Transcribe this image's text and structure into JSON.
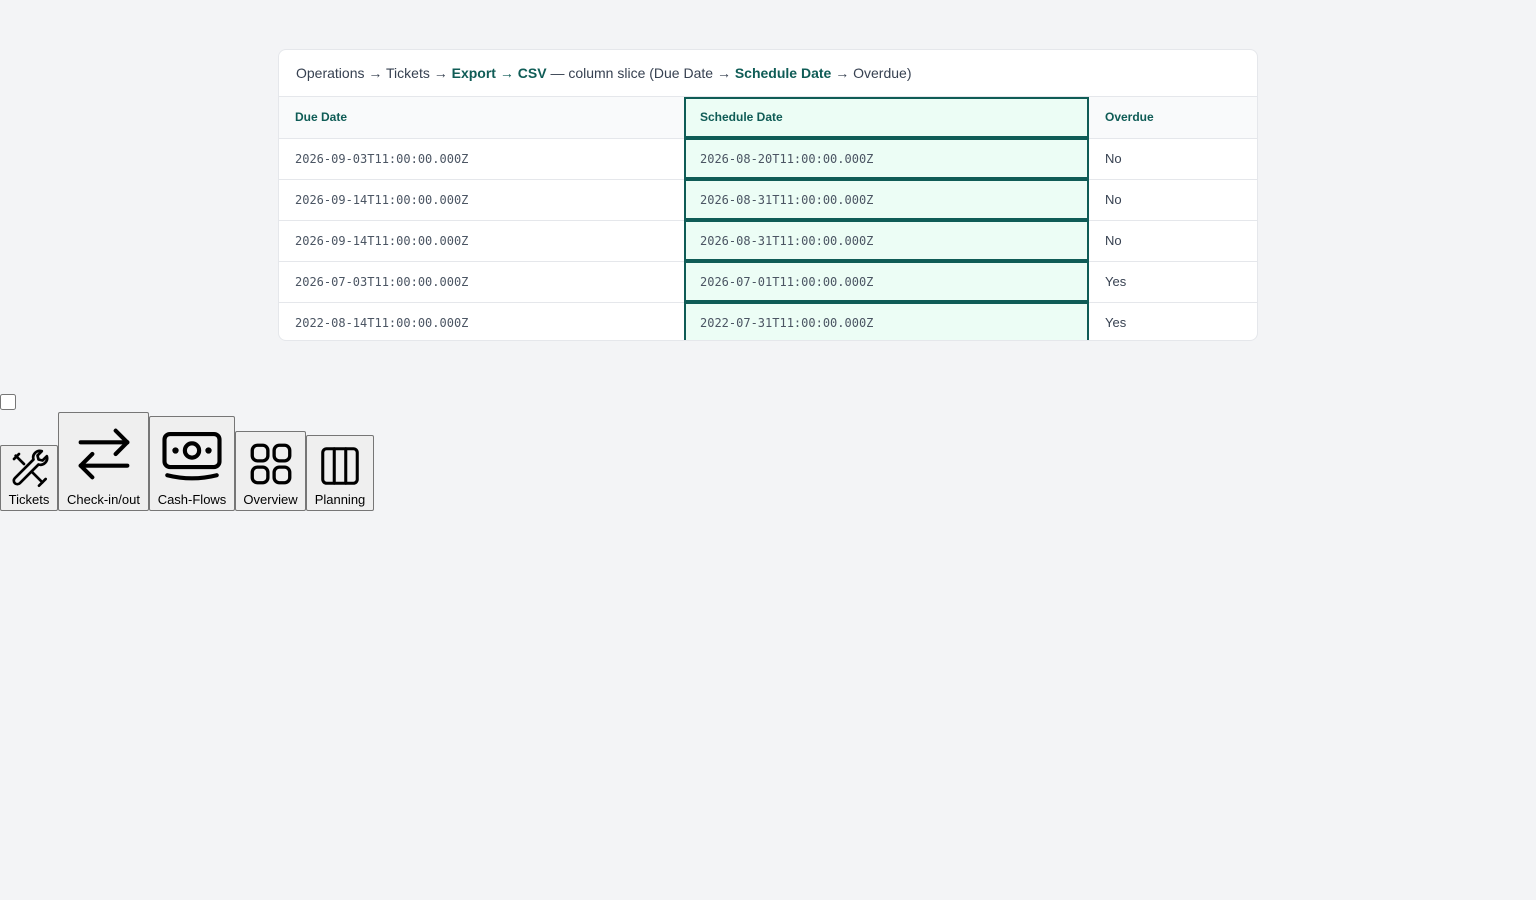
{
  "breadcrumb": {
    "seg1": "Operations",
    "seg2": "Tickets",
    "seg3": "Export",
    "seg4": "CSV",
    "desc_prefix": "— column slice (",
    "col_a": "Due Date",
    "col_b": "Schedule Date",
    "col_c": "Overdue",
    "desc_suffix": ")",
    "arrow": "→"
  },
  "table": {
    "headers": [
      "Due Date",
      "Schedule Date",
      "Overdue"
    ],
    "rows": [
      [
        "2026-09-03T11:00:00.000Z",
        "2026-08-20T11:00:00.000Z",
        "No"
      ],
      [
        "2026-09-14T11:00:00.000Z",
        "2026-08-31T11:00:00.000Z",
        "No"
      ],
      [
        "2026-09-14T11:00:00.000Z",
        "2026-08-31T11:00:00.000Z",
        "No"
      ],
      [
        "2026-07-03T11:00:00.000Z",
        "2026-07-01T11:00:00.000Z",
        "Yes"
      ],
      [
        "2022-08-14T11:00:00.000Z",
        "2022-07-31T11:00:00.000Z",
        "Yes"
      ]
    ]
  },
  "toolbar": {
    "tickets": "Tickets",
    "checkinout": "Check-in/out",
    "cashflows": "Cash-Flows",
    "overview": "Overview",
    "planning": "Planning"
  },
  "icons": {
    "tickets": "tools-icon",
    "checkinout": "arrows-swap-icon",
    "cashflows": "money-icon",
    "overview": "grid-icon",
    "planning": "columns-icon"
  },
  "colors": {
    "accent": "#0f5c56",
    "selected_bg": "#ecfdf5"
  }
}
